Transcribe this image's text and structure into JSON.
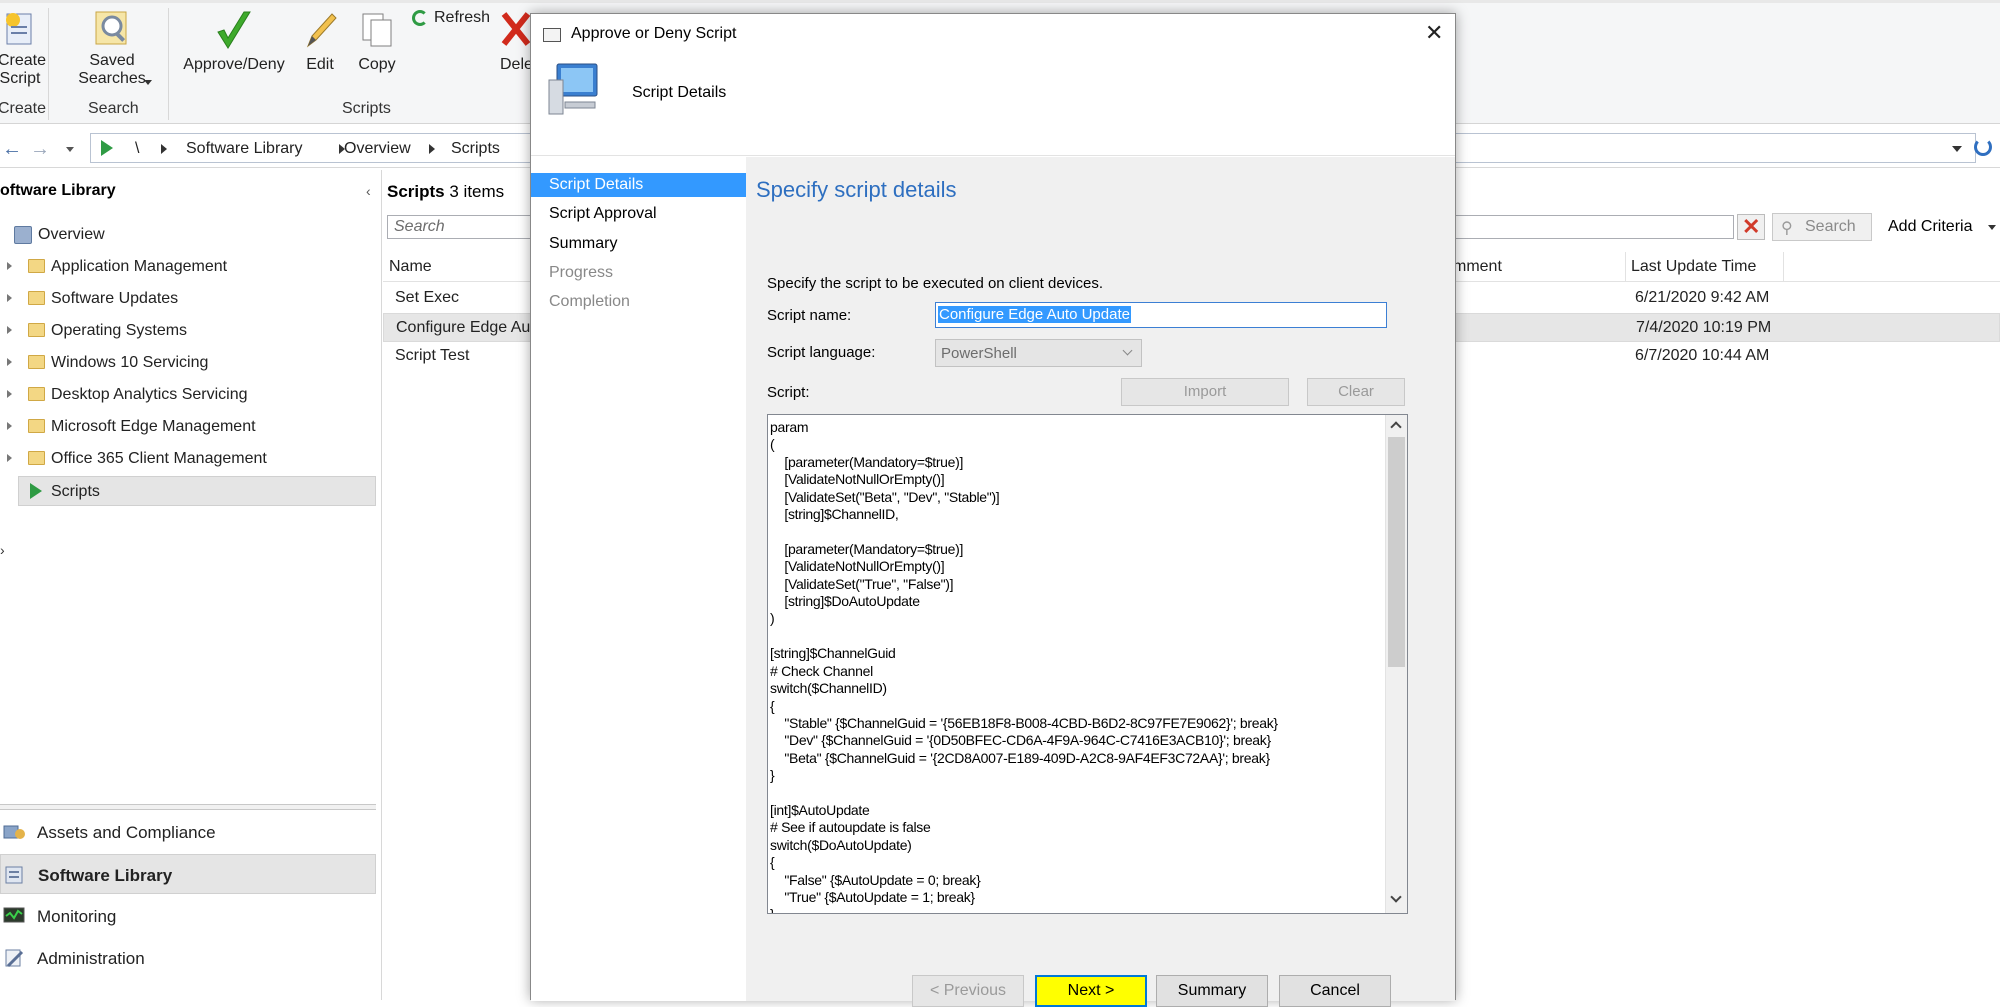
{
  "ribbon": {
    "buttons": {
      "create_script": "Create\nScript",
      "saved_searches": "Saved\nSearches",
      "approve_deny": "Approve/Deny",
      "edit": "Edit",
      "copy": "Copy",
      "refresh": "Refresh",
      "delete": "Dele"
    },
    "groups": {
      "create": "Create",
      "search": "Search",
      "scripts": "Scripts"
    }
  },
  "breadcrumb": {
    "root": "\\",
    "items": [
      "Software Library",
      "Overview",
      "Scripts"
    ]
  },
  "leftnav": {
    "title": "oftware Library",
    "items": [
      {
        "label": "Overview"
      },
      {
        "label": "Application Management"
      },
      {
        "label": "Software Updates"
      },
      {
        "label": "Operating Systems"
      },
      {
        "label": "Windows 10 Servicing"
      },
      {
        "label": "Desktop Analytics Servicing"
      },
      {
        "label": "Microsoft Edge Management"
      },
      {
        "label": "Office 365 Client Management"
      },
      {
        "label": "Scripts"
      }
    ],
    "workspaces": [
      {
        "label": "Assets and Compliance"
      },
      {
        "label": "Software Library"
      },
      {
        "label": "Monitoring"
      },
      {
        "label": "Administration"
      }
    ]
  },
  "mainlist": {
    "title": "Scripts",
    "count": "3 items",
    "search_placeholder": "Search",
    "search_button": "Search",
    "add_criteria": "Add Criteria",
    "columns": {
      "name": "Name",
      "comment": "mment",
      "last_update": "Last Update Time"
    },
    "rows": [
      {
        "name": "Set Exec",
        "last_update": "6/21/2020 9:42 AM"
      },
      {
        "name": "Configure Edge Au",
        "last_update": "7/4/2020 10:19 PM"
      },
      {
        "name": "Script Test",
        "last_update": "6/7/2020 10:44 AM"
      }
    ]
  },
  "dialog": {
    "title": "Approve or Deny Script",
    "header": "Script Details",
    "steps": [
      {
        "label": "Script Details"
      },
      {
        "label": "Script Approval"
      },
      {
        "label": "Summary"
      },
      {
        "label": "Progress"
      },
      {
        "label": "Completion"
      }
    ],
    "heading": "Specify script details",
    "instruction": "Specify the script to be executed on client devices.",
    "script_name_label": "Script name:",
    "script_name_value": "Configure Edge Auto Update",
    "script_language_label": "Script language:",
    "script_language_value": "PowerShell",
    "script_label": "Script:",
    "import_button": "Import",
    "clear_button": "Clear",
    "script_code": "param\n(\n    [parameter(Mandatory=$true)]\n    [ValidateNotNullOrEmpty()]\n    [ValidateSet(\"Beta\", \"Dev\", \"Stable\")]\n    [string]$ChannelID,\n\n    [parameter(Mandatory=$true)]\n    [ValidateNotNullOrEmpty()]\n    [ValidateSet(\"True\", \"False\")]\n    [string]$DoAutoUpdate\n)\n\n[string]$ChannelGuid\n# Check Channel\nswitch($ChannelID)\n{\n    \"Stable\" {$ChannelGuid = '{56EB18F8-B008-4CBD-B6D2-8C97FE7E9062}'; break}\n    \"Dev\" {$ChannelGuid = '{0D50BFEC-CD6A-4F9A-964C-C7416E3ACB10}'; break}\n    \"Beta\" {$ChannelGuid = '{2CD8A007-E189-409D-A2C8-9AF4EF3C72AA}'; break}\n}\n\n[int]$AutoUpdate\n# See if autoupdate is false\nswitch($DoAutoUpdate)\n{\n    \"False\" {$AutoUpdate = 0; break}\n    \"True\" {$AutoUpdate = 1; break}\n}",
    "buttons": {
      "previous": "< Previous",
      "next": "Next >",
      "summary": "Summary",
      "cancel": "Cancel"
    }
  },
  "colors": {
    "accent": "#3399ff",
    "heading_blue": "#2e6fc0",
    "highlight_yellow": "#ffff00"
  }
}
